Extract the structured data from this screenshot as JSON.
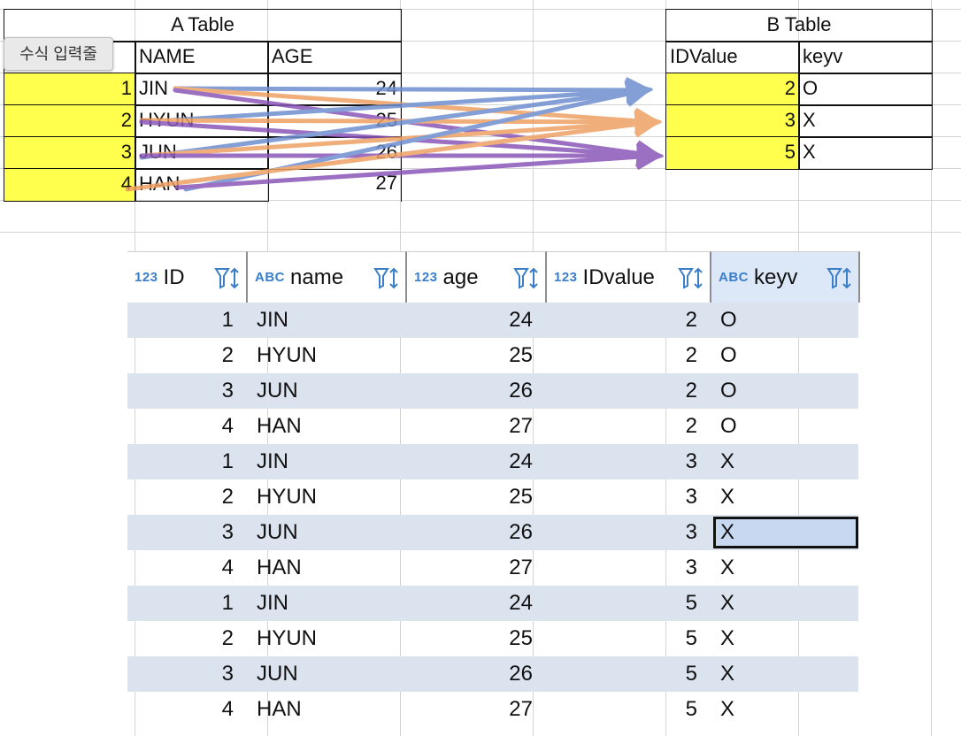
{
  "tooltip": "수식 입력줄",
  "a_table": {
    "title": "A Table",
    "headers": [
      "NAME",
      "AGE"
    ],
    "rows": [
      {
        "id": "1",
        "name": "JIN",
        "age": "24"
      },
      {
        "id": "2",
        "name": "HYUN",
        "age": "25"
      },
      {
        "id": "3",
        "name": "JUN",
        "age": "26"
      },
      {
        "id": "4",
        "name": "HAN",
        "age": "27"
      }
    ]
  },
  "b_table": {
    "title": "B Table",
    "headers": [
      "IDValue",
      "keyv"
    ],
    "rows": [
      {
        "idvalue": "2",
        "keyv": "O"
      },
      {
        "idvalue": "3",
        "keyv": "X"
      },
      {
        "idvalue": "5",
        "keyv": "X"
      }
    ]
  },
  "grid": {
    "columns": [
      {
        "type": "123",
        "name": "ID"
      },
      {
        "type": "ABC",
        "name": "name"
      },
      {
        "type": "123",
        "name": "age"
      },
      {
        "type": "123",
        "name": "IDvalue"
      },
      {
        "type": "ABC",
        "name": "keyv"
      }
    ],
    "rows": [
      [
        "1",
        "JIN",
        "24",
        "2",
        "O"
      ],
      [
        "2",
        "HYUN",
        "25",
        "2",
        "O"
      ],
      [
        "3",
        "JUN",
        "26",
        "2",
        "O"
      ],
      [
        "4",
        "HAN",
        "27",
        "2",
        "O"
      ],
      [
        "1",
        "JIN",
        "24",
        "3",
        "X"
      ],
      [
        "2",
        "HYUN",
        "25",
        "3",
        "X"
      ],
      [
        "3",
        "JUN",
        "26",
        "3",
        "X"
      ],
      [
        "4",
        "HAN",
        "27",
        "3",
        "X"
      ],
      [
        "1",
        "JIN",
        "24",
        "5",
        "X"
      ],
      [
        "2",
        "HYUN",
        "25",
        "5",
        "X"
      ],
      [
        "3",
        "JUN",
        "26",
        "5",
        "X"
      ],
      [
        "4",
        "HAN",
        "27",
        "5",
        "X"
      ]
    ],
    "selected_row": 6,
    "selected_col": 4
  },
  "colors": {
    "highlight_yellow": "#ffff4d",
    "arrow_blue": "#6f8fd0",
    "arrow_orange": "#eea064",
    "arrow_purple": "#8a56b8",
    "row_alt": "#dbe3ef",
    "type_icon": "#3a7ec9"
  }
}
